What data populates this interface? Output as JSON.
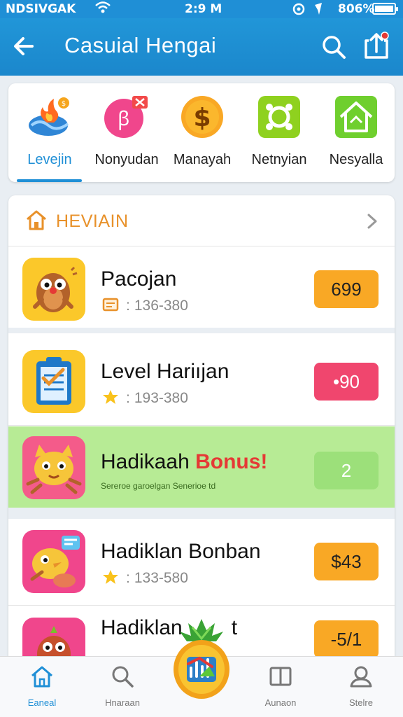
{
  "status_bar": {
    "carrier": "NDSIVGAK",
    "time": "2:9 M",
    "battery": "806%"
  },
  "app_bar": {
    "title": "Casuial Hengai",
    "icons": [
      "back-arrow-icon",
      "search-icon",
      "share-icon"
    ]
  },
  "categories": [
    {
      "label": "Levejin",
      "icon": "flame-wave-icon",
      "active": true
    },
    {
      "label": "Nonyudan",
      "icon": "pink-tag-icon",
      "active": false
    },
    {
      "label": "Manayah",
      "icon": "dollar-coin-icon",
      "active": false
    },
    {
      "label": "Netnyian",
      "icon": "green-badge-icon",
      "active": false
    },
    {
      "label": "Nesyalla",
      "icon": "green-house-icon",
      "active": false
    }
  ],
  "section": {
    "title": "HEVIAIN"
  },
  "rows": [
    {
      "title": "Pacojan",
      "sub": "136-380",
      "badge": "699",
      "badge_color": "#f9a825"
    },
    {
      "title": "Level Hariıjan",
      "sub": "193-380",
      "badge": "•90",
      "badge_color": "#f0466e"
    },
    {
      "title_a": "Hadikaah",
      "title_b": "Bonus!",
      "note": "Sereroe garoelgan Senerioe td",
      "badge": "2",
      "badge_color": "#9ce07a"
    },
    {
      "title": "Hadiklan Bonban",
      "sub": "133-580",
      "badge": "$43",
      "badge_color": "#f9a825"
    },
    {
      "title": "Hadiklan",
      "title_tail": "t",
      "badge": "-5/1",
      "badge_color": "#f9a825"
    }
  ],
  "tab_bar": {
    "tabs": [
      {
        "label": "Eaneal",
        "icon": "home-icon",
        "active": true
      },
      {
        "label": "Hnaraan",
        "icon": "search-icon",
        "active": false
      },
      {
        "label": "Aunaon",
        "icon": "book-icon",
        "active": false
      },
      {
        "label": "Stelre",
        "icon": "profile-icon",
        "active": false
      }
    ],
    "fab_icon": "pineapple-chart-icon"
  },
  "colors": {
    "primary": "#1f8fd6",
    "accent_orange": "#f9a825",
    "accent_pink": "#f0466e",
    "bonus_green": "#b7eb95",
    "section_title": "#e8912a"
  }
}
